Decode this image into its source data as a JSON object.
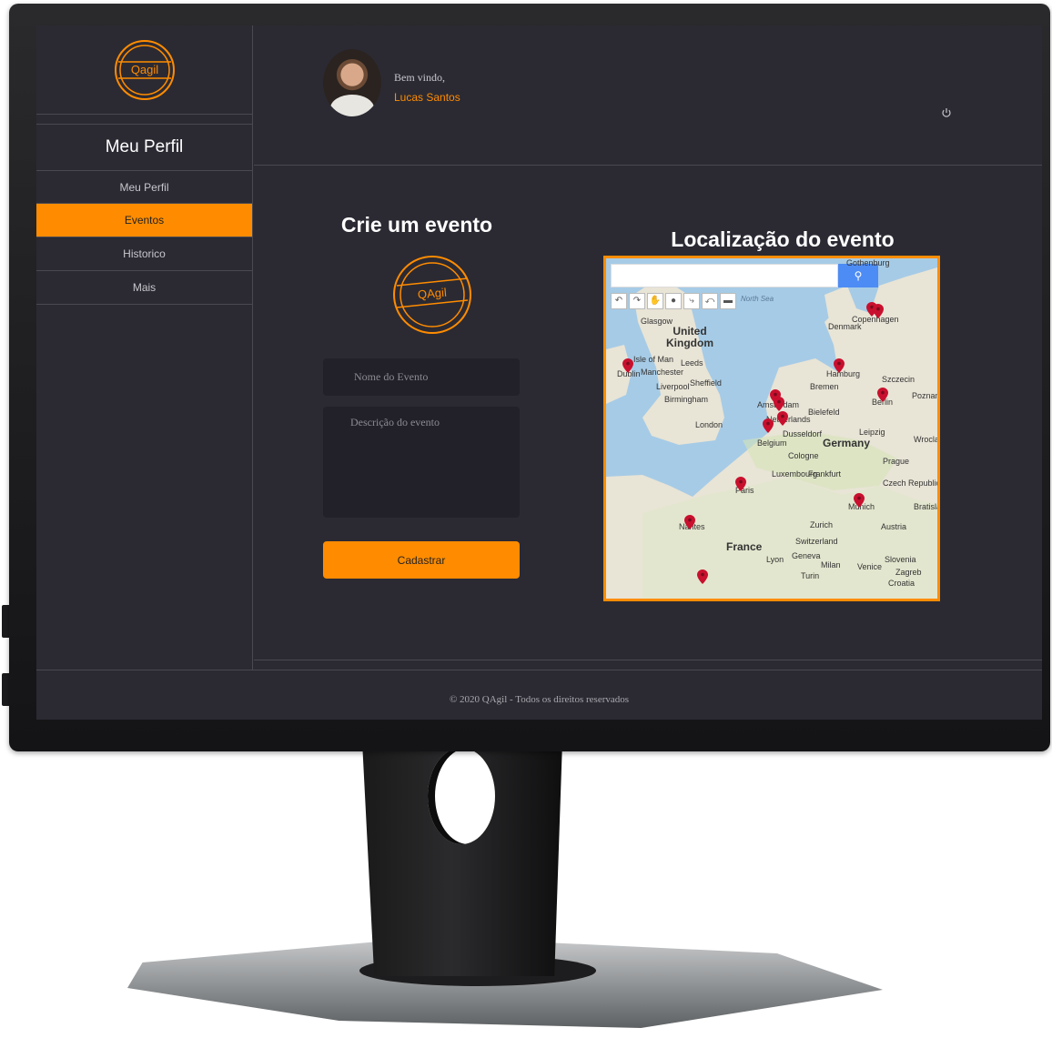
{
  "app": {
    "brand": "QAgil",
    "logo_text": "Qagil"
  },
  "sidebar": {
    "title": "Meu Perfil",
    "items": [
      {
        "label": "Meu Perfil",
        "active": false
      },
      {
        "label": "Eventos",
        "active": true
      },
      {
        "label": "Historico",
        "active": false
      },
      {
        "label": "Mais",
        "active": false
      }
    ]
  },
  "header": {
    "welcome": "Bem vindo,",
    "user_name": "Lucas Santos",
    "power_icon": "power-icon"
  },
  "form": {
    "title": "Crie um evento",
    "logo_text": "QAgil",
    "name_placeholder": "Nome do Evento",
    "description_placeholder": "Descrição do evento",
    "submit_label": "Cadastrar"
  },
  "map": {
    "title": "Localização do evento",
    "search_icon": "search-icon",
    "labels": {
      "gothenburg": "Gothenburg",
      "copenhagen": "Copenhagen",
      "denmark": "Denmark",
      "north_sea": "North Sea",
      "glasgow": "Glasgow",
      "uk": "United Kingdom",
      "isle_of_man": "Isle of Man",
      "dublin": "Dublin",
      "leeds": "Leeds",
      "manchester": "Manchester",
      "sheffield": "Sheffield",
      "liverpool": "Liverpool",
      "birmingham": "Birmingham",
      "london": "London",
      "hamburg": "Hamburg",
      "bremen": "Bremen",
      "szczecin": "Szczecin",
      "berlin": "Berlin",
      "poznan": "Poznan",
      "amsterdam": "Amsterdam",
      "netherlands": "Netherlands",
      "bielefeld": "Bielefeld",
      "dusseldorf": "Dusseldorf",
      "belgium": "Belgium",
      "leipzig": "Leipzig",
      "germany": "Germany",
      "wroclaw": "Wroclaw",
      "cologne": "Cologne",
      "luxembourg": "Luxembourg",
      "frankfurt": "Frankfurt",
      "prague": "Prague",
      "paris": "Paris",
      "czech": "Czech Republic",
      "munich": "Munich",
      "bratislava": "Bratisla",
      "nantes": "Nantes",
      "austria": "Austria",
      "zurich": "Zurich",
      "france": "France",
      "switzerland": "Switzerland",
      "slovenia": "Slovenia",
      "lyon": "Lyon",
      "geneva": "Geneva",
      "milan": "Milan",
      "venice": "Venice",
      "zagreb": "Zagreb",
      "turin": "Turin",
      "croatia": "Croatia"
    }
  },
  "footer": {
    "text": "© 2020 QAgil - Todos os direitos reservados"
  }
}
